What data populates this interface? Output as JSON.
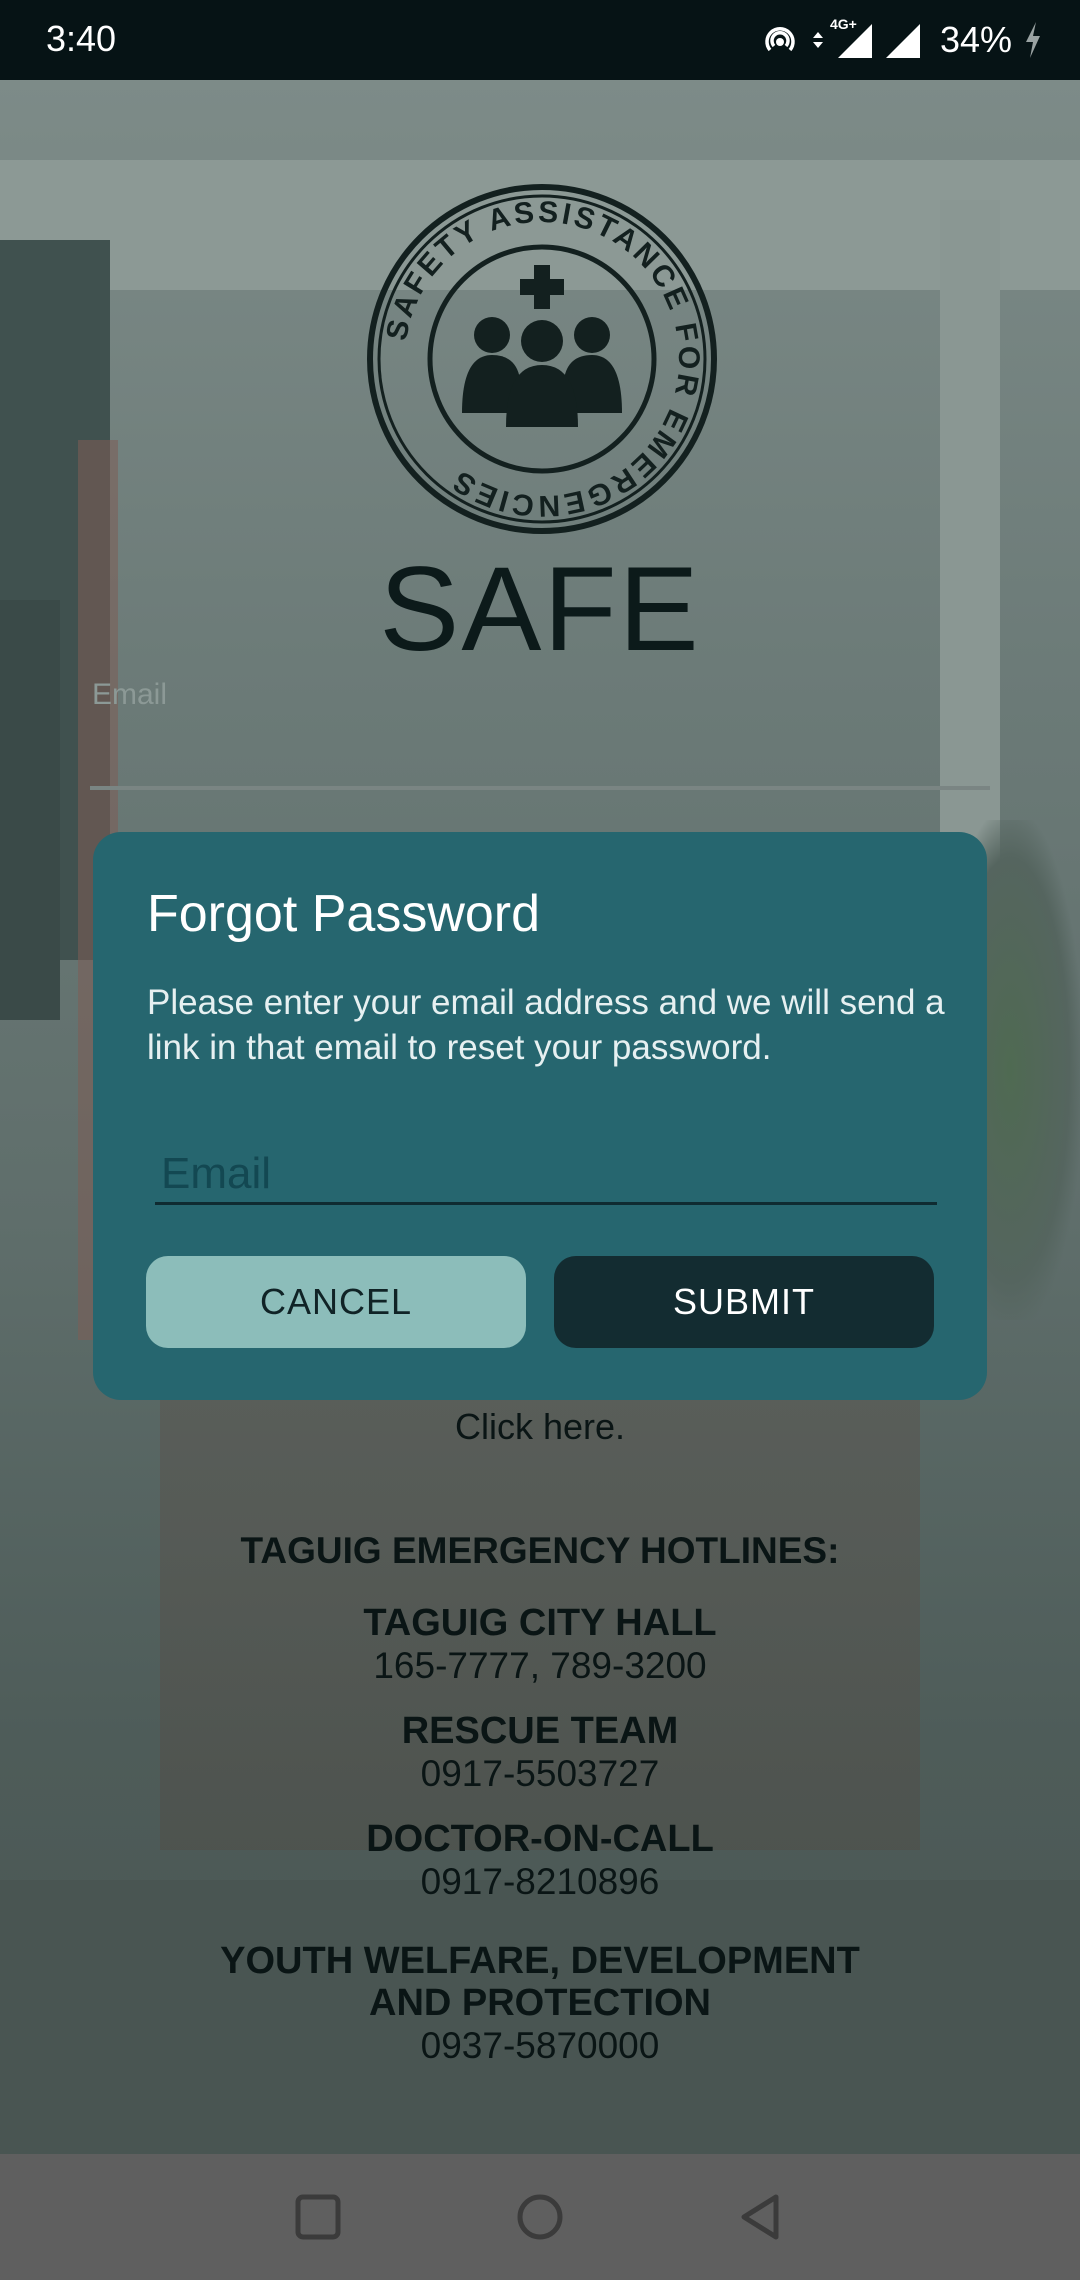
{
  "status_bar": {
    "time": "3:40",
    "network": "4G+",
    "battery": "34%",
    "icons": [
      "hotspot-icon",
      "data-arrows-icon",
      "signal-icon",
      "signal-icon",
      "charging-icon"
    ]
  },
  "logo": {
    "ring_text": "SAFETY ASSISTANCE FOR EMERGENCIES",
    "icon": "people-with-cross-icon"
  },
  "brand_title": "SAFE",
  "login_form": {
    "email_label": "Email"
  },
  "background_link": "Click here.",
  "hotlines": {
    "title": "TAGUIG EMERGENCY HOTLINES:",
    "entries": [
      {
        "name": "TAGUIG CITY HALL",
        "number": "165-7777, 789-3200"
      },
      {
        "name": "RESCUE TEAM",
        "number": "0917-5503727"
      },
      {
        "name": "DOCTOR-ON-CALL",
        "number": "0917-8210896"
      },
      {
        "name_line1": "YOUTH WELFARE, DEVELOPMENT",
        "name_line2": "AND PROTECTION",
        "number": "0937-5870000"
      }
    ]
  },
  "dialog": {
    "title": "Forgot Password",
    "message": "Please enter your email address and we will send a link in that email to reset your password.",
    "email_placeholder": "Email",
    "cancel_label": "CANCEL",
    "submit_label": "SUBMIT"
  },
  "nav_bar": {
    "icons": [
      "recents-square-icon",
      "home-circle-icon",
      "back-triangle-icon"
    ]
  },
  "colors": {
    "dialog_bg": "#26666f",
    "cancel_bg": "#8cbdba",
    "submit_bg": "#132c31",
    "status_bar_bg": "#061315"
  }
}
